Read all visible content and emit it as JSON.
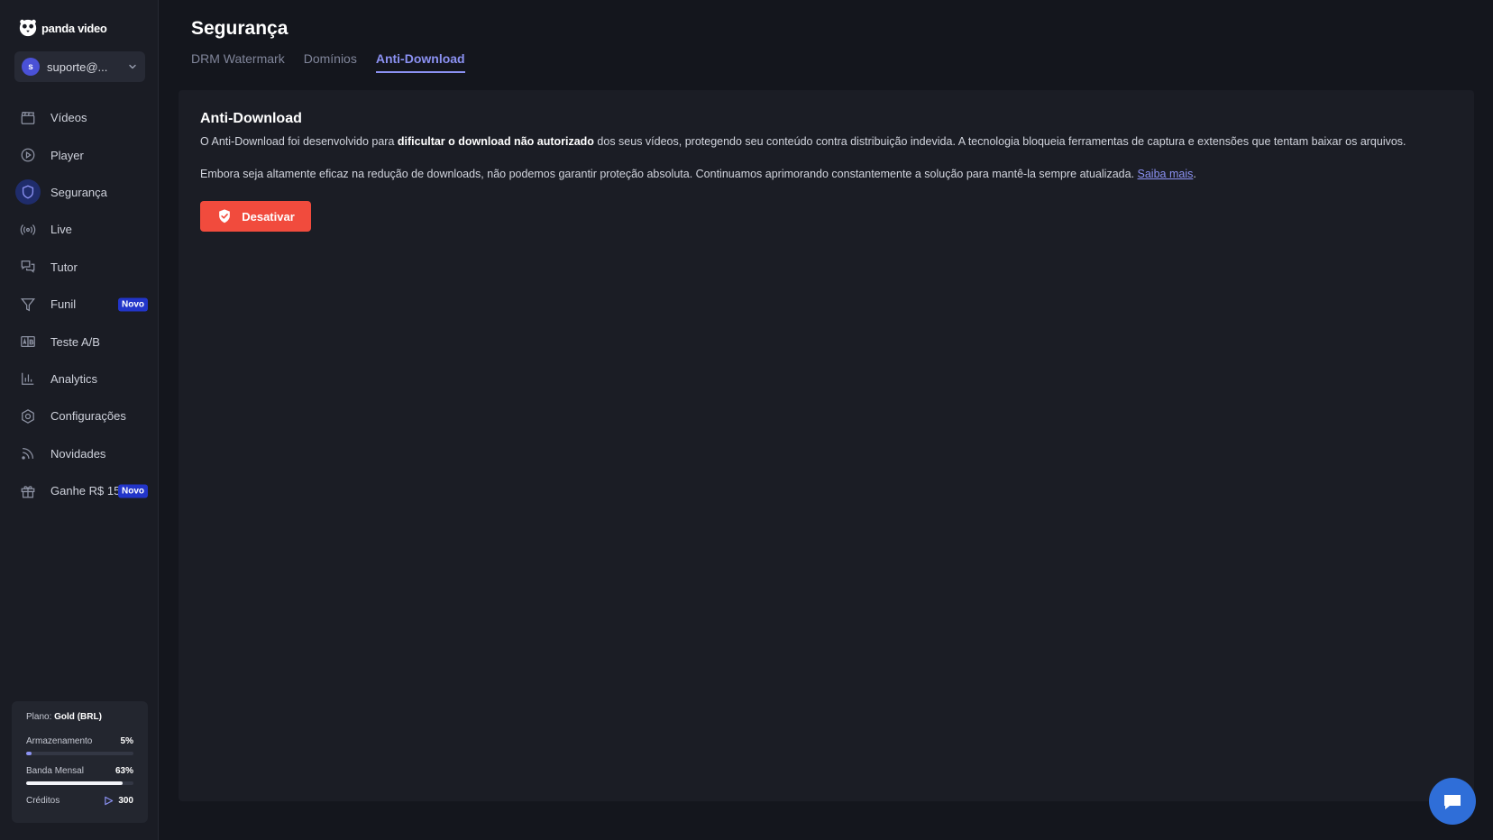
{
  "brand": {
    "name": "panda video"
  },
  "account": {
    "initial": "s",
    "email": "suporte@..."
  },
  "sidebar": {
    "items": [
      {
        "label": "Vídeos",
        "icon": "clapperboard-icon"
      },
      {
        "label": "Player",
        "icon": "play-circle-icon"
      },
      {
        "label": "Segurança",
        "icon": "shield-icon",
        "active": true
      },
      {
        "label": "Live",
        "icon": "broadcast-icon"
      },
      {
        "label": "Tutor",
        "icon": "chat-bubbles-icon"
      },
      {
        "label": "Funil",
        "icon": "funnel-icon",
        "badge": "Novo"
      },
      {
        "label": "Teste A/B",
        "icon": "ab-test-icon"
      },
      {
        "label": "Analytics",
        "icon": "bar-chart-icon"
      },
      {
        "label": "Configurações",
        "icon": "gear-icon"
      },
      {
        "label": "Novidades",
        "icon": "rss-icon"
      },
      {
        "label": "Ganhe R$ 150",
        "icon": "gift-icon",
        "badge": "Novo"
      }
    ]
  },
  "plan": {
    "label": "Plano:",
    "name": "Gold (BRL)",
    "storage": {
      "label": "Armazenamento",
      "value": "5%",
      "fraction": 0.05
    },
    "bandwidth": {
      "label": "Banda Mensal",
      "value": "63%",
      "fraction": 0.9
    },
    "credits": {
      "label": "Créditos",
      "value": "300"
    }
  },
  "page": {
    "title": "Segurança",
    "tabs": [
      {
        "label": "DRM Watermark"
      },
      {
        "label": "Domínios"
      },
      {
        "label": "Anti-Download",
        "active": true
      }
    ]
  },
  "card": {
    "title": "Anti-Download",
    "p1_before": "O Anti-Download foi desenvolvido para ",
    "p1_bold": "dificultar o download não autorizado",
    "p1_after": " dos seus vídeos, protegendo seu conteúdo contra distribuição indevida. A tecnologia bloqueia ferramentas de captura e extensões que tentam baixar os arquivos.",
    "p2_text": "Embora seja altamente eficaz na redução de downloads, não podemos garantir proteção absoluta. Continuamos aprimorando constantemente a solução para mantê-la sempre atualizada. ",
    "p2_link": "Saiba mais",
    "p2_end": ".",
    "button": "Desativar"
  },
  "colors": {
    "accent": "#8b91f2",
    "danger": "#f14b3d",
    "badge": "#2235c9",
    "chat": "#2f6ed8"
  }
}
